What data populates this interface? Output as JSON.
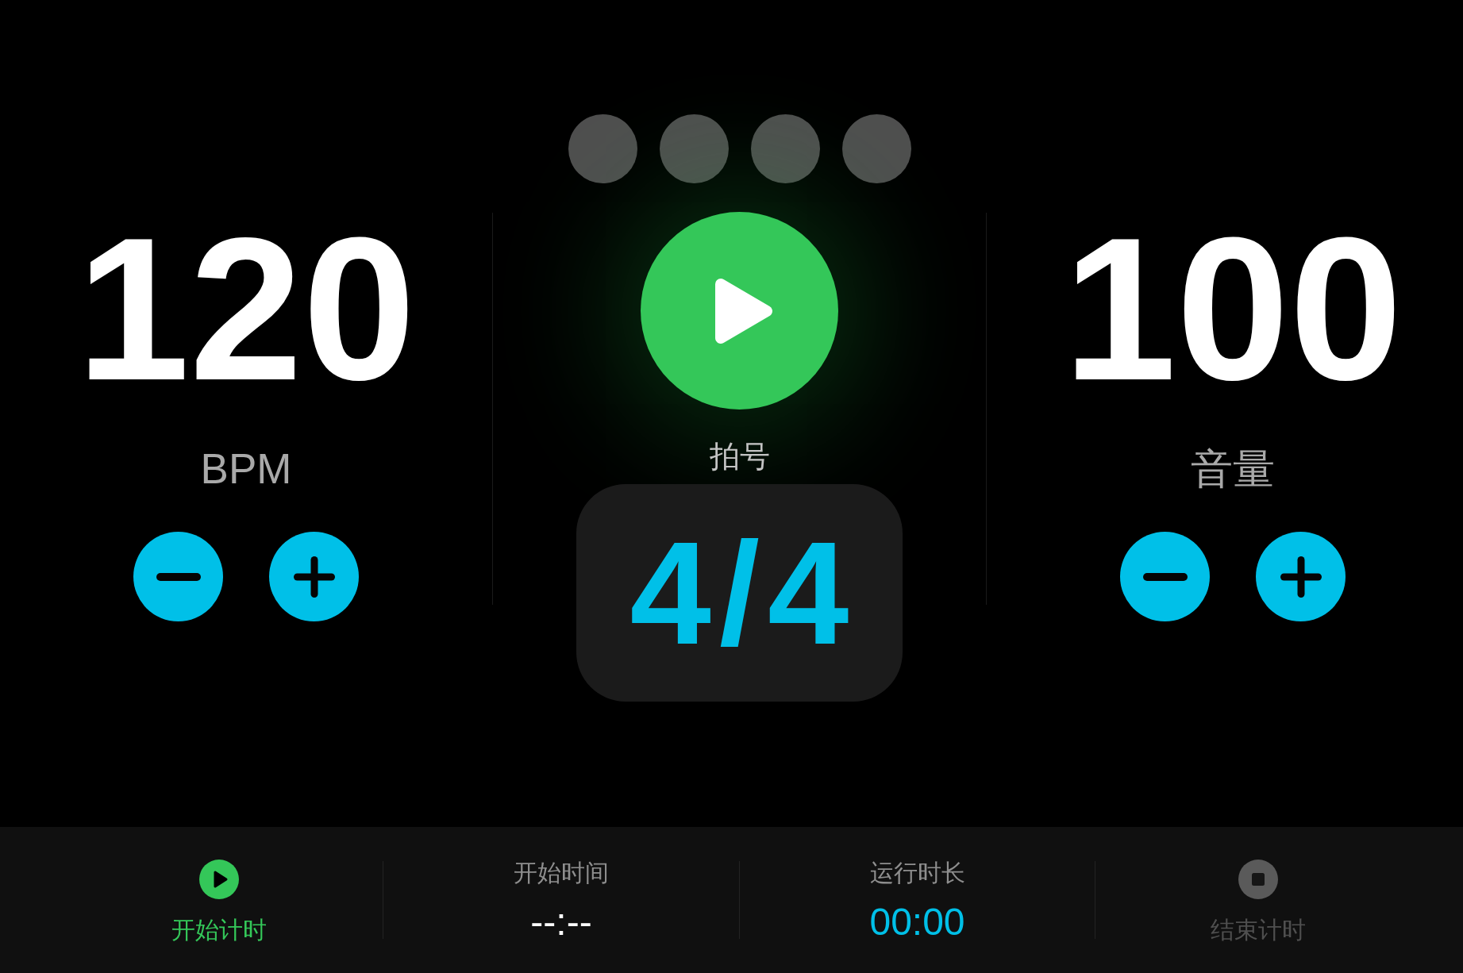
{
  "beat_indicators": [
    {
      "active": false
    },
    {
      "active": false
    },
    {
      "active": false
    },
    {
      "active": false
    }
  ],
  "tempo": {
    "value": "120",
    "label": "BPM"
  },
  "transport": {
    "playing": false
  },
  "time_signature": {
    "label": "拍号",
    "value": "4/4"
  },
  "volume": {
    "value": "100",
    "label": "音量"
  },
  "timer_bar": [
    {
      "kind": "start",
      "label": "开始计时",
      "disabled": false
    },
    {
      "kind": "readout",
      "label": "开始时间",
      "value": "--:--",
      "color": "#ffffff"
    },
    {
      "kind": "readout",
      "label": "运行时长",
      "value": "00:00",
      "color": "#00c0e8"
    },
    {
      "kind": "stop",
      "label": "结束计时",
      "disabled": true
    }
  ]
}
